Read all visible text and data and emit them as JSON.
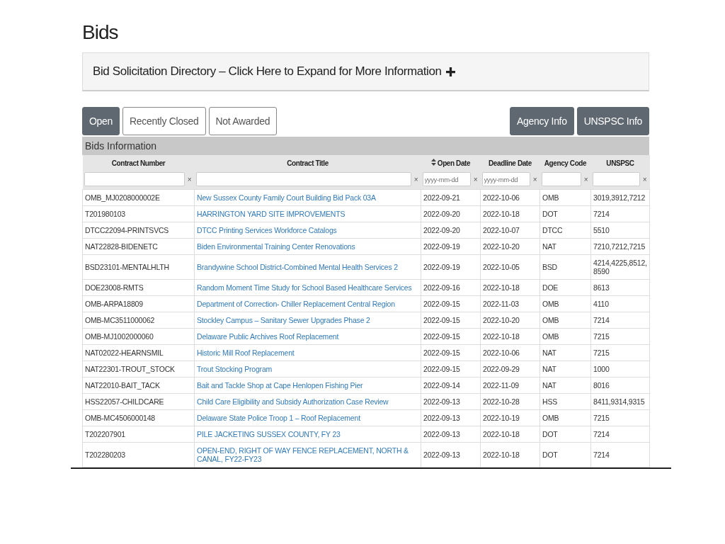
{
  "page_title": "Bids",
  "directory": {
    "label": "Bid Solicitation Directory – Click Here to Expand for More Information",
    "expanded": false
  },
  "tabs": [
    {
      "label": "Open",
      "selected": true
    },
    {
      "label": "Recently Closed",
      "selected": false
    },
    {
      "label": "Not Awarded",
      "selected": false
    }
  ],
  "buttons": [
    "Agency Info",
    "UNSPSC Info"
  ],
  "table": {
    "caption": "Bids Information",
    "columns": [
      {
        "label": "Contract Number",
        "sorted": false
      },
      {
        "label": "Contract Title",
        "sorted": false
      },
      {
        "label": "Open Date",
        "sorted": true,
        "placeholder": "yyyy-mm-dd"
      },
      {
        "label": "Deadline Date",
        "sorted": false,
        "placeholder": "yyyy-mm-dd"
      },
      {
        "label": "Agency Code",
        "sorted": false
      },
      {
        "label": "UNSPSC",
        "sorted": false
      }
    ],
    "clear_mark": "×",
    "rows": [
      [
        "OMB_MJ0208000002E",
        "New Sussex County Family Court Building Bid Pack 03A",
        "2022-09-21",
        "2022-10-06",
        "OMB",
        "3019,3912,7212"
      ],
      [
        "T201980103",
        "HARRINGTON YARD SITE IMPROVEMENTS",
        "2022-09-20",
        "2022-10-18",
        "DOT",
        "7214"
      ],
      [
        "DTCC22094-PRINTSVCS",
        "DTCC Printing Services Workforce Catalogs",
        "2022-09-20",
        "2022-10-07",
        "DTCC",
        "5510"
      ],
      [
        "NAT22828-BIDENETC",
        "Biden Environmental Training Center Renovations",
        "2022-09-19",
        "2022-10-20",
        "NAT",
        "7210,7212,7215"
      ],
      [
        "BSD23101-MENTALHLTH",
        "Brandywine School District-Combined Mental Health Services 2",
        "2022-09-19",
        "2022-10-05",
        "BSD",
        "4214,4225,8512,8590"
      ],
      [
        "DOE23008-RMTS",
        "Random Moment Time Study for School Based Healthcare Services",
        "2022-09-16",
        "2022-10-18",
        "DOE",
        "8613"
      ],
      [
        "OMB-ARPA18809",
        "Department of Correction- Chiller Replacement Central Region",
        "2022-09-15",
        "2022-11-03",
        "OMB",
        "4110"
      ],
      [
        "OMB-MC3511000062",
        "Stockley Campus – Sanitary Sewer Upgrades Phase 2",
        "2022-09-15",
        "2022-10-20",
        "OMB",
        "7214"
      ],
      [
        "OMB-MJ1002000060",
        "Delaware Public Archives Roof Replacement",
        "2022-09-15",
        "2022-10-18",
        "OMB",
        "7215"
      ],
      [
        "NAT02022-HEARNSMIL",
        "Historic Mill Roof Replacement",
        "2022-09-15",
        "2022-10-06",
        "NAT",
        "7215"
      ],
      [
        "NAT22301-TROUT_STOCK",
        "Trout Stocking Program",
        "2022-09-15",
        "2022-09-29",
        "NAT",
        "1000"
      ],
      [
        "NAT22010-BAIT_TACK",
        "Bait and Tackle Shop at Cape Henlopen Fishing Pier",
        "2022-09-14",
        "2022-11-09",
        "NAT",
        "8016"
      ],
      [
        "HSS22057-CHILDCARE",
        "Child Care Eligibility and Subsidy Authorization Case Review",
        "2022-09-13",
        "2022-10-28",
        "HSS",
        "8411,9314,9315"
      ],
      [
        "OMB-MC4506000148",
        "Delaware State Police Troop 1 – Roof Replacement",
        "2022-09-13",
        "2022-10-19",
        "OMB",
        "7215"
      ],
      [
        "T202207901",
        "PILE JACKETING SUSSEX COUNTY, FY 23",
        "2022-09-13",
        "2022-10-18",
        "DOT",
        "7214"
      ],
      [
        "T202280203",
        "OPEN-END, RIGHT OF WAY FENCE REPLACEMENT, NORTH & CANAL, FY22-FY23",
        "2022-09-13",
        "2022-10-18",
        "DOT",
        "7214"
      ]
    ]
  }
}
